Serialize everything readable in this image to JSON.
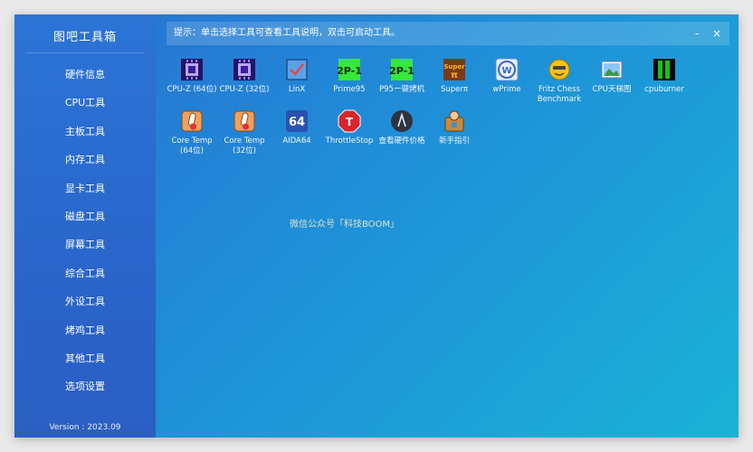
{
  "app": {
    "title": "图吧工具箱",
    "version": "Version : 2023.09"
  },
  "sidebar": {
    "items": [
      {
        "label": "硬件信息"
      },
      {
        "label": "CPU工具"
      },
      {
        "label": "主板工具"
      },
      {
        "label": "内存工具"
      },
      {
        "label": "显卡工具"
      },
      {
        "label": "磁盘工具"
      },
      {
        "label": "屏幕工具"
      },
      {
        "label": "综合工具"
      },
      {
        "label": "外设工具"
      },
      {
        "label": "烤鸡工具"
      },
      {
        "label": "其他工具"
      },
      {
        "label": "选项设置"
      }
    ]
  },
  "topbar": {
    "hint": "提示：单击选择工具可查看工具说明，双击可启动工具。",
    "minimize": "-",
    "close": "×"
  },
  "tools": [
    {
      "label": "CPU-Z (64位)",
      "icon": "cpu-z-icon"
    },
    {
      "label": "CPU-Z (32位)",
      "icon": "cpu-z-icon"
    },
    {
      "label": "LinX",
      "icon": "linx-icon"
    },
    {
      "label": "Prime95",
      "icon": "prime95-icon"
    },
    {
      "label": "P95一键烤机",
      "icon": "prime95-icon"
    },
    {
      "label": "Superπ",
      "icon": "superpi-icon"
    },
    {
      "label": "wPrime",
      "icon": "wprime-icon"
    },
    {
      "label": "Fritz Chess\nBenchmark",
      "icon": "fritz-icon"
    },
    {
      "label": "CPU天梯图",
      "icon": "image-icon"
    },
    {
      "label": "cpuburner",
      "icon": "cpuburner-icon"
    },
    {
      "label": "Core Temp\n(64位)",
      "icon": "coretemp-icon"
    },
    {
      "label": "Core Temp\n(32位)",
      "icon": "coretemp-icon"
    },
    {
      "label": "AIDA64",
      "icon": "aida64-icon"
    },
    {
      "label": "ThrottleStop",
      "icon": "throttlestop-icon"
    },
    {
      "label": "查看硬件价格",
      "icon": "price-icon"
    },
    {
      "label": "新手指引",
      "icon": "guide-icon"
    }
  ],
  "icon_text": {
    "aida": "64",
    "throttle": "T",
    "prime": "2P-1",
    "superpi": "Super\nπ",
    "wprime": "W"
  },
  "watermark": "微信公众号「科技BOOM」"
}
